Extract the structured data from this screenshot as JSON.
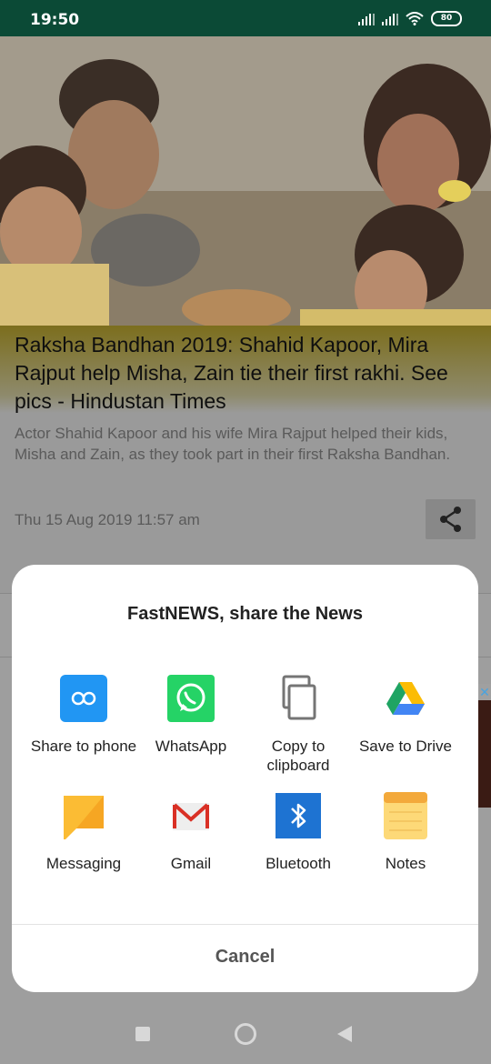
{
  "status_bar": {
    "time": "19:50",
    "battery": "80"
  },
  "article": {
    "headline": "Raksha Bandhan 2019: Shahid Kapoor, Mira Rajput help Misha, Zain tie their first rakhi. See pics - Hindustan Times",
    "summary": "Actor Shahid Kapoor and his wife Mira Rajput helped their kids, Misha and Zain, as they took part in their first Raksha Bandhan.",
    "date": "Thu 15 Aug 2019 11:57 am",
    "share_icon": "share-icon"
  },
  "ad": {
    "close": "✕"
  },
  "share_sheet": {
    "title": "FastNEWS, share the News",
    "apps": [
      {
        "label": "Share to phone",
        "icon": "share-to-phone-icon",
        "color": "#2196f3"
      },
      {
        "label": "WhatsApp",
        "icon": "whatsapp-icon",
        "color": "#25d366"
      },
      {
        "label": "Copy to clipboard",
        "icon": "copy-icon",
        "color": "#757575"
      },
      {
        "label": "Save to Drive",
        "icon": "google-drive-icon",
        "color": "#1fa463"
      },
      {
        "label": "Messaging",
        "icon": "messaging-icon",
        "color": "#fbbc34"
      },
      {
        "label": "Gmail",
        "icon": "gmail-icon",
        "color": "#d93025"
      },
      {
        "label": "Bluetooth",
        "icon": "bluetooth-icon",
        "color": "#1e73d2"
      },
      {
        "label": "Notes",
        "icon": "notes-icon",
        "color": "#f7c14a"
      }
    ],
    "cancel": "Cancel"
  },
  "nav_bar": {
    "recent": "recent-apps-icon",
    "home": "home-icon",
    "back": "back-icon"
  }
}
